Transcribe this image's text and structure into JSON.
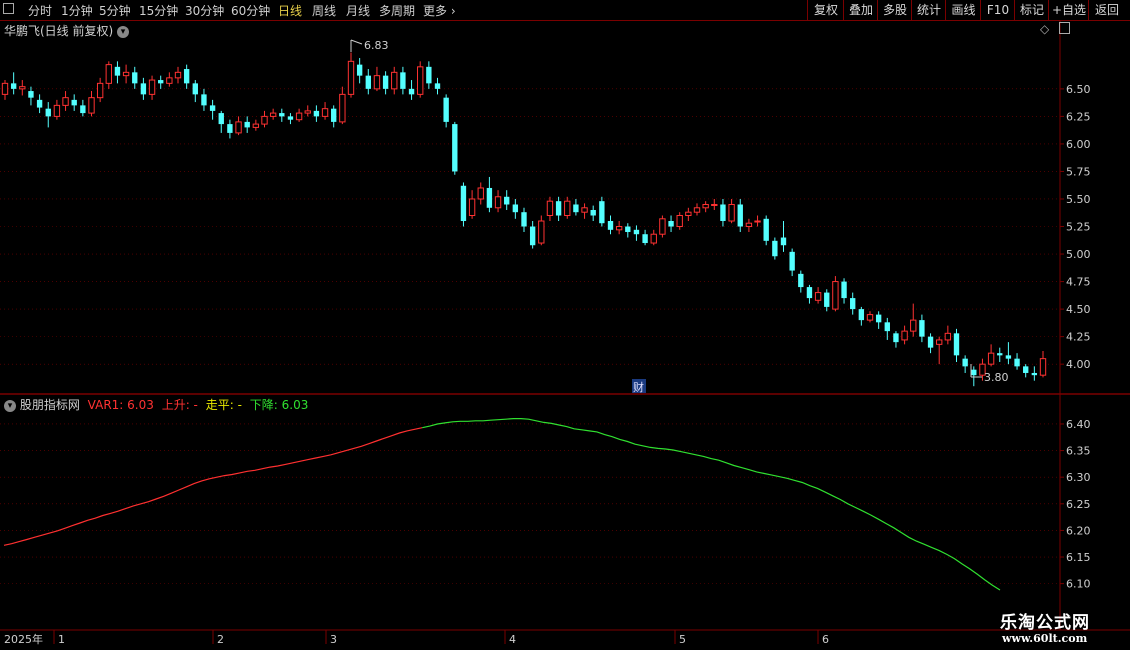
{
  "toolbar": {
    "periods": [
      "分时",
      "1分钟",
      "5分钟",
      "15分钟",
      "30分钟",
      "60分钟",
      "日线",
      "周线",
      "月线",
      "多周期",
      "更多"
    ],
    "active_period": "日线",
    "buttons": [
      "复权",
      "叠加",
      "多股",
      "统计",
      "画线",
      "F10",
      "标记",
      "+自选",
      "返回"
    ]
  },
  "main_header": {
    "title": "华鹏飞(日线 前复权)"
  },
  "indicator_header": {
    "name": "股朋指标网",
    "var1_label": "VAR1: 6.03",
    "rise_label": "上升: -",
    "flat_label": "走平: -",
    "fall_label": "下降: 6.03"
  },
  "annotations": {
    "high_label": "6.83",
    "low_label": "3.80",
    "cai_label": "财"
  },
  "time_axis": {
    "year_label": "2025年",
    "months": [
      "1",
      "2",
      "3",
      "4",
      "5",
      "6"
    ]
  },
  "watermark": {
    "line1": "乐淘公式网",
    "line2": "www.60lt.com"
  },
  "colors": {
    "up": "#ff3232",
    "down": "#54ffff",
    "rise_line": "#ff3030",
    "fall_line": "#30e030",
    "flat_color": "#e8e800",
    "grid": "#7a0000",
    "axis_text": "#c8c8c8"
  },
  "chart_data": [
    {
      "type": "candlestick",
      "title": "华鹏飞(日线 前复权)",
      "y_ticks": [
        4.0,
        4.25,
        4.5,
        4.75,
        5.0,
        5.25,
        5.5,
        5.75,
        6.0,
        6.25,
        6.5
      ],
      "ylim": [
        3.72,
        6.98
      ],
      "x_month_labels": [
        "1",
        "2",
        "3",
        "4",
        "5",
        "6"
      ],
      "high_annotation": 6.83,
      "low_annotation": 3.8,
      "candles": [
        [
          6.45,
          6.55,
          6.4,
          6.58
        ],
        [
          6.55,
          6.5,
          6.45,
          6.65
        ],
        [
          6.5,
          6.52,
          6.44,
          6.58
        ],
        [
          6.48,
          6.42,
          6.35,
          6.52
        ],
        [
          6.4,
          6.33,
          6.28,
          6.45
        ],
        [
          6.32,
          6.25,
          6.15,
          6.38
        ],
        [
          6.25,
          6.35,
          6.22,
          6.4
        ],
        [
          6.35,
          6.42,
          6.3,
          6.48
        ],
        [
          6.4,
          6.35,
          6.3,
          6.45
        ],
        [
          6.35,
          6.28,
          6.25,
          6.4
        ],
        [
          6.28,
          6.42,
          6.25,
          6.48
        ],
        [
          6.42,
          6.55,
          6.38,
          6.6
        ],
        [
          6.55,
          6.72,
          6.5,
          6.75
        ],
        [
          6.7,
          6.62,
          6.55,
          6.75
        ],
        [
          6.62,
          6.65,
          6.55,
          6.72
        ],
        [
          6.65,
          6.55,
          6.5,
          6.7
        ],
        [
          6.55,
          6.45,
          6.4,
          6.6
        ],
        [
          6.45,
          6.58,
          6.4,
          6.62
        ],
        [
          6.58,
          6.55,
          6.5,
          6.62
        ],
        [
          6.55,
          6.6,
          6.52,
          6.65
        ],
        [
          6.6,
          6.65,
          6.55,
          6.7
        ],
        [
          6.68,
          6.55,
          6.5,
          6.72
        ],
        [
          6.55,
          6.45,
          6.38,
          6.58
        ],
        [
          6.45,
          6.35,
          6.3,
          6.5
        ],
        [
          6.35,
          6.3,
          6.22,
          6.4
        ],
        [
          6.28,
          6.18,
          6.1,
          6.3
        ],
        [
          6.18,
          6.1,
          6.05,
          6.22
        ],
        [
          6.1,
          6.2,
          6.08,
          6.25
        ],
        [
          6.2,
          6.15,
          6.1,
          6.25
        ],
        [
          6.15,
          6.18,
          6.12,
          6.22
        ],
        [
          6.18,
          6.25,
          6.15,
          6.3
        ],
        [
          6.25,
          6.28,
          6.22,
          6.32
        ],
        [
          6.28,
          6.25,
          6.2,
          6.32
        ],
        [
          6.25,
          6.22,
          6.18,
          6.28
        ],
        [
          6.22,
          6.28,
          6.2,
          6.32
        ],
        [
          6.28,
          6.3,
          6.25,
          6.35
        ],
        [
          6.3,
          6.25,
          6.2,
          6.35
        ],
        [
          6.25,
          6.32,
          6.22,
          6.38
        ],
        [
          6.32,
          6.2,
          6.15,
          6.35
        ],
        [
          6.2,
          6.45,
          6.18,
          6.52
        ],
        [
          6.45,
          6.75,
          6.42,
          6.83
        ],
        [
          6.72,
          6.62,
          6.55,
          6.78
        ],
        [
          6.62,
          6.5,
          6.45,
          6.68
        ],
        [
          6.5,
          6.62,
          6.48,
          6.7
        ],
        [
          6.62,
          6.5,
          6.45,
          6.66
        ],
        [
          6.5,
          6.65,
          6.45,
          6.7
        ],
        [
          6.65,
          6.5,
          6.45,
          6.7
        ],
        [
          6.5,
          6.45,
          6.4,
          6.58
        ],
        [
          6.45,
          6.7,
          6.42,
          6.75
        ],
        [
          6.7,
          6.55,
          6.5,
          6.75
        ],
        [
          6.55,
          6.5,
          6.45,
          6.6
        ],
        [
          6.42,
          6.2,
          6.15,
          6.45
        ],
        [
          6.18,
          5.75,
          5.72,
          6.2
        ],
        [
          5.62,
          5.3,
          5.25,
          5.65
        ],
        [
          5.35,
          5.5,
          5.32,
          5.58
        ],
        [
          5.5,
          5.6,
          5.45,
          5.65
        ],
        [
          5.6,
          5.42,
          5.38,
          5.7
        ],
        [
          5.42,
          5.52,
          5.38,
          5.58
        ],
        [
          5.52,
          5.45,
          5.4,
          5.58
        ],
        [
          5.45,
          5.38,
          5.32,
          5.5
        ],
        [
          5.38,
          5.25,
          5.2,
          5.42
        ],
        [
          5.25,
          5.08,
          5.05,
          5.3
        ],
        [
          5.1,
          5.3,
          5.08,
          5.35
        ],
        [
          5.35,
          5.48,
          5.3,
          5.52
        ],
        [
          5.48,
          5.35,
          5.3,
          5.52
        ],
        [
          5.35,
          5.48,
          5.32,
          5.52
        ],
        [
          5.45,
          5.38,
          5.35,
          5.5
        ],
        [
          5.38,
          5.42,
          5.32,
          5.46
        ],
        [
          5.4,
          5.35,
          5.3,
          5.44
        ],
        [
          5.48,
          5.28,
          5.25,
          5.52
        ],
        [
          5.3,
          5.22,
          5.18,
          5.35
        ],
        [
          5.22,
          5.25,
          5.18,
          5.3
        ],
        [
          5.25,
          5.2,
          5.15,
          5.28
        ],
        [
          5.22,
          5.18,
          5.12,
          5.26
        ],
        [
          5.18,
          5.1,
          5.08,
          5.22
        ],
        [
          5.1,
          5.18,
          5.08,
          5.22
        ],
        [
          5.18,
          5.32,
          5.15,
          5.35
        ],
        [
          5.3,
          5.25,
          5.2,
          5.35
        ],
        [
          5.25,
          5.35,
          5.22,
          5.38
        ],
        [
          5.35,
          5.38,
          5.3,
          5.42
        ],
        [
          5.38,
          5.42,
          5.35,
          5.46
        ],
        [
          5.42,
          5.45,
          5.38,
          5.48
        ],
        [
          5.45,
          5.45,
          5.4,
          5.5
        ],
        [
          5.45,
          5.3,
          5.25,
          5.5
        ],
        [
          5.3,
          5.45,
          5.28,
          5.5
        ],
        [
          5.45,
          5.25,
          5.2,
          5.5
        ],
        [
          5.25,
          5.28,
          5.2,
          5.32
        ],
        [
          5.3,
          5.3,
          5.25,
          5.35
        ],
        [
          5.32,
          5.12,
          5.08,
          5.35
        ],
        [
          5.12,
          4.98,
          4.95,
          5.15
        ],
        [
          5.15,
          5.08,
          5.02,
          5.3
        ],
        [
          5.02,
          4.85,
          4.8,
          5.05
        ],
        [
          4.82,
          4.7,
          4.65,
          4.85
        ],
        [
          4.7,
          4.6,
          4.55,
          4.72
        ],
        [
          4.58,
          4.65,
          4.55,
          4.7
        ],
        [
          4.65,
          4.52,
          4.48,
          4.68
        ],
        [
          4.5,
          4.75,
          4.48,
          4.8
        ],
        [
          4.75,
          4.6,
          4.55,
          4.78
        ],
        [
          4.6,
          4.5,
          4.45,
          4.65
        ],
        [
          4.5,
          4.4,
          4.35,
          4.52
        ],
        [
          4.4,
          4.45,
          4.38,
          4.48
        ],
        [
          4.45,
          4.38,
          4.32,
          4.48
        ],
        [
          4.38,
          4.3,
          4.22,
          4.42
        ],
        [
          4.28,
          4.2,
          4.15,
          4.3
        ],
        [
          4.22,
          4.3,
          4.18,
          4.35
        ],
        [
          4.3,
          4.4,
          4.25,
          4.55
        ],
        [
          4.4,
          4.25,
          4.2,
          4.45
        ],
        [
          4.25,
          4.15,
          4.1,
          4.28
        ],
        [
          4.18,
          4.22,
          4.0,
          4.25
        ],
        [
          4.22,
          4.28,
          4.18,
          4.35
        ],
        [
          4.28,
          4.08,
          4.02,
          4.32
        ],
        [
          4.05,
          3.98,
          3.92,
          4.08
        ],
        [
          3.95,
          3.9,
          3.8,
          3.98
        ],
        [
          3.9,
          4.0,
          3.85,
          4.05
        ],
        [
          4.0,
          4.1,
          3.98,
          4.18
        ],
        [
          4.1,
          4.08,
          4.02,
          4.15
        ],
        [
          4.08,
          4.05,
          4.0,
          4.2
        ],
        [
          4.05,
          3.98,
          3.95,
          4.1
        ],
        [
          3.98,
          3.92,
          3.88,
          4.0
        ],
        [
          3.92,
          3.9,
          3.85,
          3.98
        ],
        [
          3.9,
          4.05,
          3.88,
          4.12
        ]
      ]
    },
    {
      "type": "line",
      "title": "股朋指标网",
      "series_name": "VAR1",
      "y_ticks": [
        6.1,
        6.15,
        6.2,
        6.25,
        6.3,
        6.35,
        6.4
      ],
      "ylim": [
        6.073,
        6.43
      ],
      "peak_index": 50,
      "values": [
        6.172,
        6.175,
        6.179,
        6.183,
        6.187,
        6.191,
        6.195,
        6.199,
        6.204,
        6.209,
        6.214,
        6.219,
        6.223,
        6.228,
        6.232,
        6.236,
        6.241,
        6.246,
        6.25,
        6.254,
        6.259,
        6.264,
        6.27,
        6.276,
        6.282,
        6.288,
        6.293,
        6.297,
        6.3,
        6.303,
        6.305,
        6.308,
        6.311,
        6.313,
        6.316,
        6.319,
        6.321,
        6.324,
        6.327,
        6.33,
        6.333,
        6.336,
        6.339,
        6.342,
        6.346,
        6.35,
        6.354,
        6.358,
        6.363,
        6.368,
        6.373,
        6.378,
        6.383,
        6.387,
        6.39,
        6.393,
        6.396,
        6.4,
        6.402,
        6.404,
        6.405,
        6.405,
        6.406,
        6.406,
        6.407,
        6.408,
        6.409,
        6.41,
        6.41,
        6.409,
        6.406,
        6.403,
        6.401,
        6.398,
        6.395,
        6.391,
        6.389,
        6.387,
        6.385,
        6.38,
        6.376,
        6.371,
        6.367,
        6.362,
        6.359,
        6.356,
        6.354,
        6.353,
        6.351,
        6.348,
        6.345,
        6.342,
        6.339,
        6.335,
        6.332,
        6.327,
        6.322,
        6.318,
        6.314,
        6.31,
        6.307,
        6.304,
        6.301,
        6.298,
        6.294,
        6.29,
        6.284,
        6.279,
        6.272,
        6.265,
        6.258,
        6.25,
        6.243,
        6.236,
        6.229,
        6.221,
        6.213,
        6.205,
        6.196,
        6.187,
        6.18,
        6.174,
        6.168,
        6.162,
        6.155,
        6.147,
        6.137,
        6.128,
        6.118,
        6.107,
        6.097,
        6.088
      ]
    }
  ]
}
